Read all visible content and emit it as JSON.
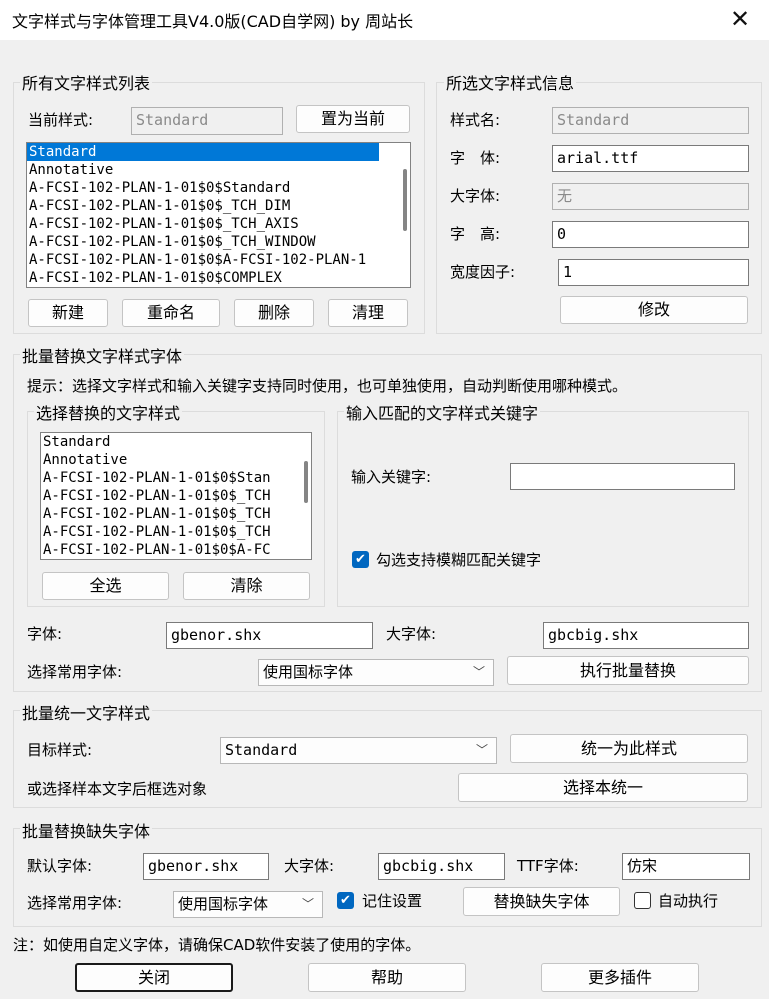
{
  "window": {
    "title": "文字样式与字体管理工具V4.0版(CAD自学网) by 周站长"
  },
  "all_styles": {
    "group_label": "所有文字样式列表",
    "current_label": "当前样式:",
    "current_value": "Standard",
    "set_current_button": "置为当前",
    "list": [
      "Standard",
      "Annotative",
      "A-FCSI-102-PLAN-1-01$0$Standard",
      "A-FCSI-102-PLAN-1-01$0$_TCH_DIM",
      "A-FCSI-102-PLAN-1-01$0$_TCH_AXIS",
      "A-FCSI-102-PLAN-1-01$0$_TCH_WINDOW",
      "A-FCSI-102-PLAN-1-01$0$A-FCSI-102-PLAN-1",
      "A-FCSI-102-PLAN-1-01$0$COMPLEX"
    ],
    "buttons": {
      "new": "新建",
      "rename": "重命名",
      "delete": "删除",
      "purge": "清理"
    }
  },
  "style_info": {
    "group_label": "所选文字样式信息",
    "name_label": "样式名:",
    "name_value": "Standard",
    "font_label": "字　体:",
    "font_value": "arial.ttf",
    "bigfont_label": "大字体:",
    "bigfont_value": "无",
    "height_label": "字　高:",
    "height_value": "0",
    "width_label": "宽度因子:",
    "width_value": "1",
    "modify_button": "修改"
  },
  "batch_replace": {
    "group_label": "批量替换文字样式字体",
    "hint": "提示：选择文字样式和输入关键字支持同时使用，也可单独使用，自动判断使用哪种模式。",
    "select_group_label": "选择替换的文字样式",
    "list": [
      "Standard",
      "Annotative",
      "A-FCSI-102-PLAN-1-01$0$Stan",
      "A-FCSI-102-PLAN-1-01$0$_TCH",
      "A-FCSI-102-PLAN-1-01$0$_TCH",
      "A-FCSI-102-PLAN-1-01$0$_TCH",
      "A-FCSI-102-PLAN-1-01$0$A-FC"
    ],
    "select_all_button": "全选",
    "clear_button": "清除",
    "keyword_group_label": "输入匹配的文字样式关键字",
    "keyword_label": "输入关键字:",
    "keyword_value": "",
    "fuzzy_label": "勾选支持模糊匹配关键字",
    "font_label": "字体:",
    "font_value": "gbenor.shx",
    "bigfont_label": "大字体:",
    "bigfont_value": "gbcbig.shx",
    "common_font_label": "选择常用字体:",
    "common_font_value": "使用国标字体",
    "execute_button": "执行批量替换"
  },
  "unify": {
    "group_label": "批量统一文字样式",
    "target_label": "目标样式:",
    "target_value": "Standard",
    "unify_button": "统一为此样式",
    "or_label": "或选择样本文字后框选对象",
    "sample_button": "选择本统一"
  },
  "missing_font": {
    "group_label": "批量替换缺失字体",
    "default_font_label": "默认字体:",
    "default_font_value": "gbenor.shx",
    "bigfont_label": "大字体:",
    "bigfont_value": "gbcbig.shx",
    "ttf_label": "TTF字体:",
    "ttf_value": "仿宋",
    "common_font_label": "选择常用字体:",
    "common_font_value": "使用国标字体",
    "remember_label": "记住设置",
    "replace_button": "替换缺失字体",
    "auto_label": "自动执行"
  },
  "footer": {
    "note": "注：如使用自定义字体，请确保CAD软件安装了使用的字体。",
    "close_button": "关闭",
    "help_button": "帮助",
    "more_button": "更多插件"
  }
}
